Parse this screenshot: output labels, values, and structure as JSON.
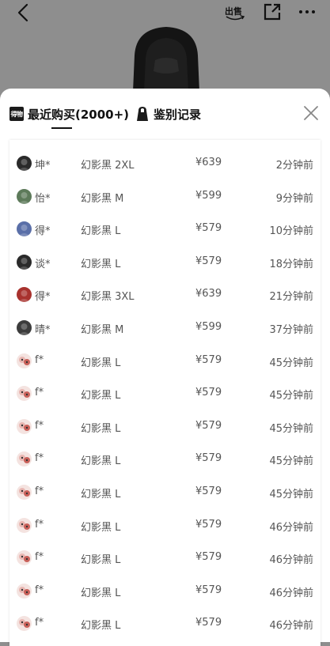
{
  "topbar": {
    "sell_label": "出售"
  },
  "tabs": {
    "recent_label": "最近购买(2000+)",
    "recent_badge": "得物",
    "auth_label": "鉴别记录"
  },
  "purchases": [
    {
      "name": "坤*",
      "spec": "幻影黑 2XL",
      "price": "¥639",
      "time": "2分钟前",
      "avatar": "dark"
    },
    {
      "name": "怡*",
      "spec": "幻影黑 M",
      "price": "¥599",
      "time": "9分钟前",
      "avatar": "green"
    },
    {
      "name": "得*",
      "spec": "幻影黑 L",
      "price": "¥579",
      "time": "10分钟前",
      "avatar": "blue"
    },
    {
      "name": "谈*",
      "spec": "幻影黑 L",
      "price": "¥579",
      "time": "18分钟前",
      "avatar": "dark"
    },
    {
      "name": "得*",
      "spec": "幻影黑 3XL",
      "price": "¥639",
      "time": "21分钟前",
      "avatar": "red"
    },
    {
      "name": "晴*",
      "spec": "幻影黑 M",
      "price": "¥599",
      "time": "37分钟前",
      "avatar": "gray"
    },
    {
      "name": "f*",
      "spec": "幻影黑 L",
      "price": "¥579",
      "time": "45分钟前",
      "avatar": "pink"
    },
    {
      "name": "f*",
      "spec": "幻影黑 L",
      "price": "¥579",
      "time": "45分钟前",
      "avatar": "pink"
    },
    {
      "name": "f*",
      "spec": "幻影黑 L",
      "price": "¥579",
      "time": "45分钟前",
      "avatar": "pink"
    },
    {
      "name": "f*",
      "spec": "幻影黑 L",
      "price": "¥579",
      "time": "45分钟前",
      "avatar": "pink"
    },
    {
      "name": "f*",
      "spec": "幻影黑 L",
      "price": "¥579",
      "time": "45分钟前",
      "avatar": "pink"
    },
    {
      "name": "f*",
      "spec": "幻影黑 L",
      "price": "¥579",
      "time": "46分钟前",
      "avatar": "pink"
    },
    {
      "name": "f*",
      "spec": "幻影黑 L",
      "price": "¥579",
      "time": "46分钟前",
      "avatar": "pink"
    },
    {
      "name": "f*",
      "spec": "幻影黑 L",
      "price": "¥579",
      "time": "46分钟前",
      "avatar": "pink"
    },
    {
      "name": "f*",
      "spec": "幻影黑 L",
      "price": "¥579",
      "time": "46分钟前",
      "avatar": "pink"
    }
  ],
  "avatar_colors": {
    "dark": "#2a2a2a",
    "green": "#5d7a5a",
    "blue": "#5a6fa8",
    "red": "#a8322e",
    "gray": "#3c3c3c",
    "pink": "#e9b7b2"
  }
}
